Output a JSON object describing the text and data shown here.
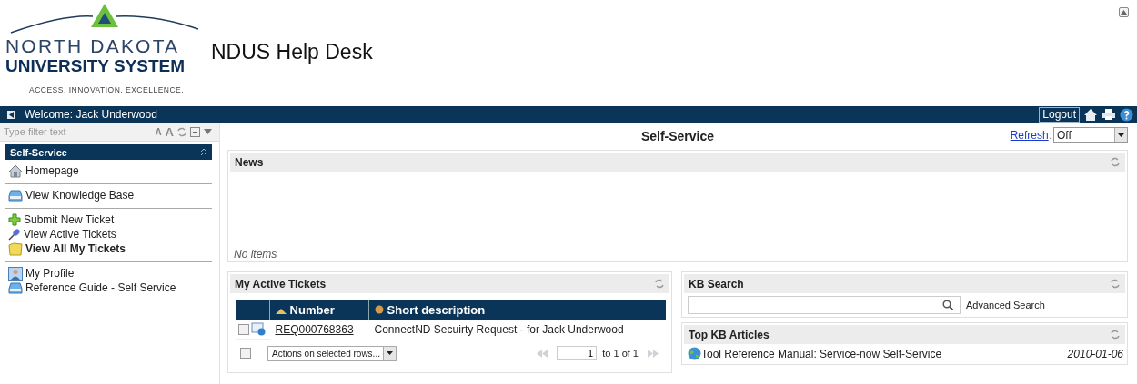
{
  "header": {
    "logo": {
      "line1": "NORTH DAKOTA",
      "line2": "UNIVERSITY SYSTEM",
      "tagline": "ACCESS. INNOVATION. EXCELLENCE."
    },
    "title": "NDUS Help Desk"
  },
  "top_bar": {
    "welcome": "Welcome: Jack Underwood",
    "logout": "Logout"
  },
  "sidebar": {
    "filter_placeholder": "Type filter text",
    "font_buttons": [
      "A",
      "A"
    ],
    "section": "Self-Service",
    "groups": [
      [
        {
          "label": "Homepage",
          "kind": "home",
          "bold": false
        }
      ],
      [
        {
          "label": "View Knowledge Base",
          "kind": "kb",
          "bold": false
        }
      ],
      [
        {
          "label": "Submit New Ticket",
          "kind": "add",
          "bold": false
        },
        {
          "label": "View Active Tickets",
          "kind": "pin",
          "bold": false
        },
        {
          "label": "View All My Tickets",
          "kind": "folder",
          "bold": true
        }
      ],
      [
        {
          "label": "My Profile",
          "kind": "profile",
          "bold": false
        },
        {
          "label": "Reference Guide - Self Service",
          "kind": "kb",
          "bold": false
        }
      ]
    ]
  },
  "main": {
    "title": "Self-Service",
    "refresh_link": "Refresh",
    "refresh_sep": ":",
    "refresh_value": "Off",
    "news": {
      "title": "News",
      "empty": "No items"
    },
    "tickets": {
      "title": "My Active Tickets",
      "columns": [
        {
          "label": "Number",
          "kind": "sort"
        },
        {
          "label": "Short description",
          "kind": "box"
        }
      ],
      "rows": [
        {
          "checked": false,
          "number": "REQ000768363",
          "description": "ConnectND Secuirty Request - for Jack Underwood"
        }
      ],
      "select_all": false,
      "actions": "Actions on selected rows...",
      "page": "1",
      "page_range": "to 1 of 1"
    },
    "kb_search": {
      "title": "KB Search",
      "advanced": "Advanced Search"
    },
    "top_articles": {
      "title": "Top KB Articles",
      "items": [
        {
          "title": "Tool Reference Manual: Service-now Self-Service",
          "date": "2010-01-06"
        }
      ]
    }
  }
}
